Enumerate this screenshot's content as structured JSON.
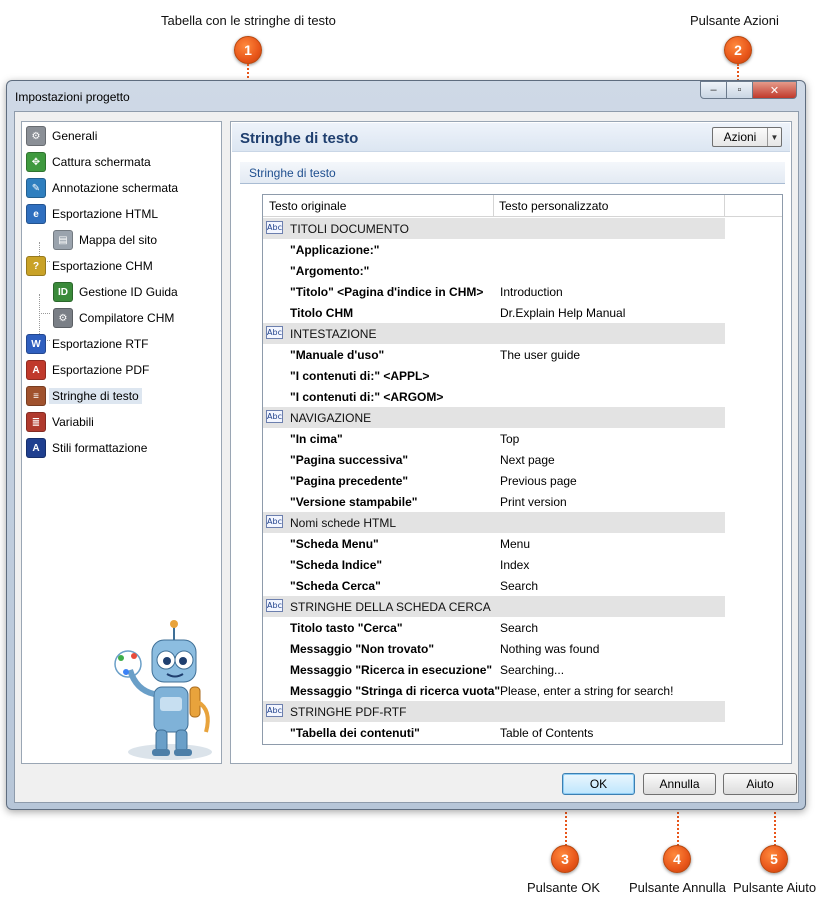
{
  "annotations": [
    {
      "number": "1",
      "label": "Tabella con le stringhe di testo"
    },
    {
      "number": "2",
      "label": "Pulsante Azioni"
    },
    {
      "number": "3",
      "label": "Pulsante OK"
    },
    {
      "number": "4",
      "label": "Pulsante Annulla"
    },
    {
      "number": "5",
      "label": "Pulsante Aiuto"
    }
  ],
  "window": {
    "title": "Impostazioni progetto",
    "controls": {
      "minimize": "–",
      "maximize": "▫",
      "close": "✕"
    }
  },
  "sidebar": {
    "items": [
      {
        "label": "Generali",
        "icon": "gear-icon",
        "color": "#8a8f96",
        "glyph": "⚙"
      },
      {
        "label": "Cattura schermata",
        "icon": "capture-icon",
        "color": "#3f9a3f",
        "glyph": "✥"
      },
      {
        "label": "Annotazione schermata",
        "icon": "annotation-icon",
        "color": "#2f7fbf",
        "glyph": "✎"
      },
      {
        "label": "Esportazione HTML",
        "icon": "html-export-icon",
        "color": "#2f6fbf",
        "glyph": "e"
      },
      {
        "label": "Mappa del sito",
        "icon": "sitemap-icon",
        "color": "#9aa3ad",
        "glyph": "▤"
      },
      {
        "label": "Esportazione CHM",
        "icon": "chm-export-icon",
        "color": "#c9a227",
        "glyph": "?"
      },
      {
        "label": "Gestione ID Guida",
        "icon": "help-id-icon",
        "color": "#3a8a3a",
        "glyph": "ID"
      },
      {
        "label": "Compilatore CHM",
        "icon": "compiler-icon",
        "color": "#7a7f86",
        "glyph": "⚙"
      },
      {
        "label": "Esportazione RTF",
        "icon": "rtf-export-icon",
        "color": "#2f5fbf",
        "glyph": "W"
      },
      {
        "label": "Esportazione PDF",
        "icon": "pdf-export-icon",
        "color": "#c0392b",
        "glyph": "A"
      },
      {
        "label": "Stringhe di testo",
        "icon": "text-strings-icon",
        "color": "#a0522d",
        "glyph": "≡"
      },
      {
        "label": "Variabili",
        "icon": "variables-icon",
        "color": "#b03a2e",
        "glyph": "≣"
      },
      {
        "label": "Stili formattazione",
        "icon": "formatting-styles-icon",
        "color": "#1f3f8f",
        "glyph": "A"
      }
    ],
    "selected": "Stringhe di testo"
  },
  "main": {
    "title": "Stringhe di testo",
    "actions_label": "Azioni",
    "section_header": "Stringhe di testo",
    "table": {
      "columns": [
        "Testo originale",
        "Testo personalizzato"
      ],
      "rows": [
        {
          "type": "group",
          "label": "TITOLI DOCUMENTO"
        },
        {
          "type": "item",
          "original": "\"Applicazione:\"",
          "custom": ""
        },
        {
          "type": "item",
          "original": "\"Argomento:\"",
          "custom": ""
        },
        {
          "type": "item",
          "original": "\"Titolo\" <Pagina d'indice in CHM>",
          "custom": "Introduction"
        },
        {
          "type": "item",
          "original": "Titolo CHM",
          "custom": "Dr.Explain Help Manual"
        },
        {
          "type": "group",
          "label": "INTESTAZIONE"
        },
        {
          "type": "item",
          "original": "\"Manuale d'uso\"",
          "custom": "The user guide"
        },
        {
          "type": "item",
          "original": "\"I contenuti di:\" <APPL>",
          "custom": ""
        },
        {
          "type": "item",
          "original": "\"I contenuti di:\" <ARGOM>",
          "custom": ""
        },
        {
          "type": "group",
          "label": "NAVIGAZIONE"
        },
        {
          "type": "item",
          "original": "\"In cima\"",
          "custom": "Top"
        },
        {
          "type": "item",
          "original": "\"Pagina successiva\"",
          "custom": "Next page"
        },
        {
          "type": "item",
          "original": "\"Pagina precedente\"",
          "custom": "Previous page"
        },
        {
          "type": "item",
          "original": "\"Versione stampabile\"",
          "custom": "Print version"
        },
        {
          "type": "group",
          "label": "Nomi schede HTML"
        },
        {
          "type": "item",
          "original": "\"Scheda Menu\"",
          "custom": "Menu"
        },
        {
          "type": "item",
          "original": "\"Scheda Indice\"",
          "custom": "Index"
        },
        {
          "type": "item",
          "original": "\"Scheda Cerca\"",
          "custom": "Search"
        },
        {
          "type": "group",
          "label": "STRINGHE DELLA SCHEDA CERCA"
        },
        {
          "type": "item",
          "original": "Titolo tasto \"Cerca\"",
          "custom": "Search"
        },
        {
          "type": "item",
          "original": "Messaggio \"Non trovato\"",
          "custom": "Nothing was found"
        },
        {
          "type": "item",
          "original": "Messaggio \"Ricerca in esecuzione\"",
          "custom": "Searching..."
        },
        {
          "type": "item",
          "original": "Messaggio \"Stringa di ricerca vuota\"",
          "custom": "Please, enter a string for search!"
        },
        {
          "type": "group",
          "label": "STRINGHE PDF-RTF"
        },
        {
          "type": "item",
          "original": "\"Tabella dei contenuti\"",
          "custom": "Table of Contents"
        }
      ]
    }
  },
  "footer": {
    "ok_label": "OK",
    "cancel_label": "Annulla",
    "help_label": "Aiuto"
  }
}
